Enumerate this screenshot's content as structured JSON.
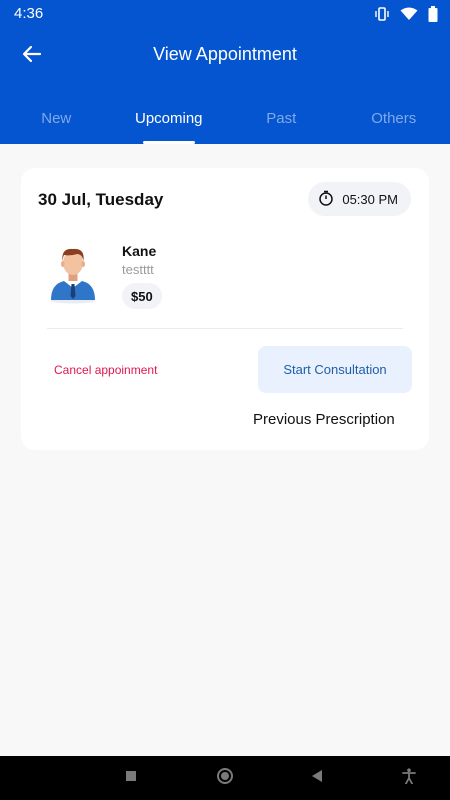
{
  "status_bar": {
    "time": "4:36",
    "icons": [
      "vibrate-icon",
      "wifi-icon",
      "battery-icon"
    ]
  },
  "app_bar": {
    "title": "View Appointment",
    "back_icon": "arrow-left-icon"
  },
  "tabs": [
    {
      "label": "New",
      "active": false
    },
    {
      "label": "Upcoming",
      "active": true
    },
    {
      "label": "Past",
      "active": false
    },
    {
      "label": "Others",
      "active": false
    }
  ],
  "appointment": {
    "date": "30 Jul, Tuesday",
    "time": "05:30 PM",
    "patient_name": "Kane",
    "patient_note": "testttt",
    "fee": "$50",
    "cancel_label": "Cancel appoinment",
    "start_label": "Start Consultation",
    "prescription_label": "Previous Prescription"
  },
  "colors": {
    "primary": "#0455cf",
    "cancel": "#e0184d",
    "start_button_bg": "#e8f1fd",
    "start_button_text": "#1f5fa6"
  },
  "nav_bar": {
    "icons": [
      "square-icon",
      "circle-icon",
      "triangle-back-icon",
      "accessibility-icon"
    ]
  }
}
